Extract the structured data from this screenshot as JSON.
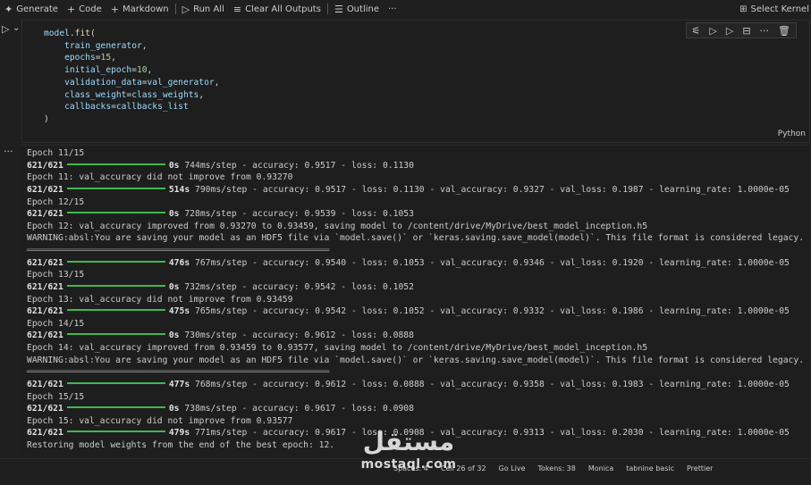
{
  "toolbar": {
    "generate": "Generate",
    "code": "Code",
    "markdown": "Markdown",
    "run_all": "Run All",
    "clear_outputs": "Clear All Outputs",
    "outline": "Outline",
    "more": "···",
    "select_kernel": "Select Kernel"
  },
  "cell": {
    "language": "Python",
    "code": [
      "model.fit(",
      "    train_generator,",
      "    epochs=15,",
      "    initial_epoch=10,",
      "    validation_data=val_generator,",
      "    class_weight=class_weights,",
      "    callbacks=callbacks_list",
      ")"
    ]
  },
  "output": {
    "lines": [
      {
        "type": "text",
        "text": "Epoch 11/15"
      },
      {
        "type": "progress",
        "steps": "621/621",
        "time": "0s",
        "rest": "744ms/step - accuracy: 0.9517 - loss: 0.1130"
      },
      {
        "type": "text",
        "text": "Epoch 11: val_accuracy did not improve from 0.93270"
      },
      {
        "type": "progress",
        "steps": "621/621",
        "time": "514s",
        "rest": "790ms/step - accuracy: 0.9517 - loss: 0.1130 - val_accuracy: 0.9327 - val_loss: 0.1987 - learning_rate: 1.0000e-05"
      },
      {
        "type": "text",
        "text": "Epoch 12/15"
      },
      {
        "type": "progress",
        "steps": "621/621",
        "time": "0s",
        "rest": "728ms/step - accuracy: 0.9539 - loss: 0.1053"
      },
      {
        "type": "text",
        "text": "Epoch 12: val_accuracy improved from 0.93270 to 0.93459, saving model to /content/drive/MyDrive/best_model_inception.h5"
      },
      {
        "type": "text",
        "text": "WARNING:absl:You are saving your model as an HDF5 file via `model.save()` or `keras.saving.save_model(model)`. This file format is considered legacy. We recom"
      },
      {
        "type": "rule"
      },
      {
        "type": "progress",
        "steps": "621/621",
        "time": "476s",
        "rest": "767ms/step - accuracy: 0.9540 - loss: 0.1053 - val_accuracy: 0.9346 - val_loss: 0.1920 - learning_rate: 1.0000e-05"
      },
      {
        "type": "text",
        "text": "Epoch 13/15"
      },
      {
        "type": "progress",
        "steps": "621/621",
        "time": "0s",
        "rest": "732ms/step - accuracy: 0.9542 - loss: 0.1052"
      },
      {
        "type": "text",
        "text": "Epoch 13: val_accuracy did not improve from 0.93459"
      },
      {
        "type": "progress",
        "steps": "621/621",
        "time": "475s",
        "rest": "765ms/step - accuracy: 0.9542 - loss: 0.1052 - val_accuracy: 0.9332 - val_loss: 0.1986 - learning_rate: 1.0000e-05"
      },
      {
        "type": "text",
        "text": "Epoch 14/15"
      },
      {
        "type": "progress",
        "steps": "621/621",
        "time": "0s",
        "rest": "730ms/step - accuracy: 0.9612 - loss: 0.0888"
      },
      {
        "type": "text",
        "text": "Epoch 14: val_accuracy improved from 0.93459 to 0.93577, saving model to /content/drive/MyDrive/best_model_inception.h5"
      },
      {
        "type": "text",
        "text": "WARNING:absl:You are saving your model as an HDF5 file via `model.save()` or `keras.saving.save_model(model)`. This file format is considered legacy. We recom"
      },
      {
        "type": "rule"
      },
      {
        "type": "progress",
        "steps": "621/621",
        "time": "477s",
        "rest": "768ms/step - accuracy: 0.9612 - loss: 0.0888 - val_accuracy: 0.9358 - val_loss: 0.1983 - learning_rate: 1.0000e-05"
      },
      {
        "type": "text",
        "text": "Epoch 15/15"
      },
      {
        "type": "progress",
        "steps": "621/621",
        "time": "0s",
        "rest": "738ms/step - accuracy: 0.9617 - loss: 0.0908"
      },
      {
        "type": "text",
        "text": "Epoch 15: val_accuracy did not improve from 0.93577"
      },
      {
        "type": "progress",
        "steps": "621/621",
        "time": "479s",
        "rest": "771ms/step - accuracy: 0.9617 - loss: 0.0908 - val_accuracy: 0.9313 - val_loss: 0.2030 - learning_rate: 1.0000e-05"
      },
      {
        "type": "text",
        "text": "Restoring model weights from the end of the best epoch: 12."
      }
    ]
  },
  "statusbar": {
    "items": [
      "Spaces: 4",
      "Cell 26 of 32",
      "Go Live",
      "Tokens: 38",
      "Monica",
      "tabnine basic",
      "Prettier"
    ]
  },
  "watermark": {
    "arabic": "مستقل",
    "latin": "mostaql.com"
  }
}
